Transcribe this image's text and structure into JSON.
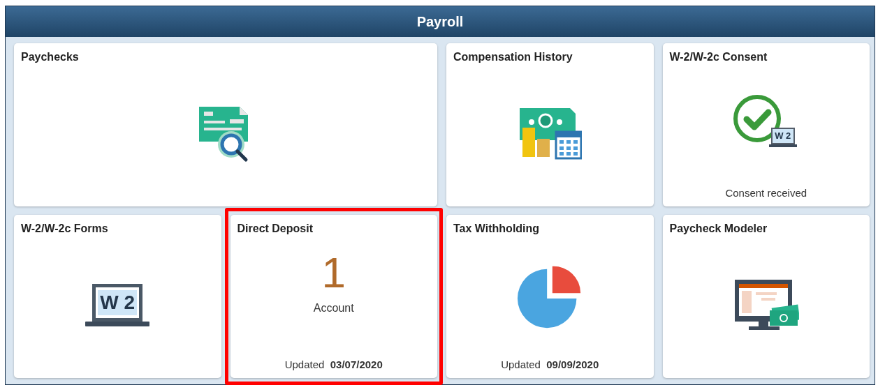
{
  "header": {
    "title": "Payroll"
  },
  "tiles": [
    {
      "title": "Paychecks",
      "kind": "paycheck",
      "highlighted": false
    },
    {
      "title": "Compensation History",
      "kind": "compensation",
      "highlighted": false
    },
    {
      "title": "W-2/W-2c Consent",
      "kind": "consent",
      "icon_text": "W 2",
      "status": "Consent received",
      "highlighted": false
    },
    {
      "title": "W-2/W-2c Forms",
      "kind": "w2",
      "icon_text": "W 2",
      "highlighted": false
    },
    {
      "title": "Direct Deposit",
      "kind": "count",
      "count": "1",
      "count_label": "Account",
      "updated": "Updated  **03/07/2020**",
      "highlighted": true
    },
    {
      "title": "Tax Withholding",
      "kind": "pie",
      "updated": "Updated  **09/09/2020**",
      "highlighted": false
    },
    {
      "title": "Paycheck Modeler",
      "kind": "modeler",
      "highlighted": false
    }
  ]
}
